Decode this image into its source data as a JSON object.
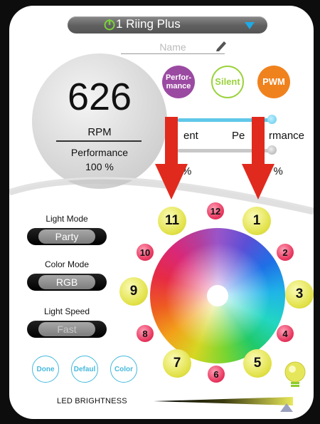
{
  "header": {
    "device_title": "1 Riing Plus",
    "name_placeholder": "Name"
  },
  "rpm": {
    "value": "626",
    "unit": "RPM",
    "mode": "Performance",
    "percent": "100 %"
  },
  "fan_modes": {
    "performance_line1": "Perfor-",
    "performance_line2": "mance",
    "silent": "Silent",
    "pwm": "PWM"
  },
  "slider": {
    "left_text": "ent",
    "right_text_a": "Pe",
    "right_text_b": "rmance",
    "low_left": "%",
    "low_right": "0 %"
  },
  "light_settings": {
    "light_mode_label": "Light Mode",
    "light_mode_value": "Party",
    "color_mode_label": "Color Mode",
    "color_mode_value": "RGB",
    "light_speed_label": "Light Speed",
    "light_speed_value": "Fast"
  },
  "bottom_buttons": {
    "done": "Done",
    "default": "Defaul",
    "color": "Color"
  },
  "leds": {
    "big": [
      "11",
      "1",
      "9",
      "3",
      "7",
      "5"
    ],
    "small": [
      "12",
      "10",
      "2",
      "8",
      "4",
      "6"
    ]
  },
  "brightness": {
    "label": "LED BRIGHTNESS",
    "level": 1.0
  },
  "colors": {
    "accent_blue": "#46b9dd",
    "performance_purple": "#9b4aa2",
    "silent_green": "#9bd23c",
    "pwm_orange": "#f0821e",
    "arrow_red": "#e02a1e"
  }
}
